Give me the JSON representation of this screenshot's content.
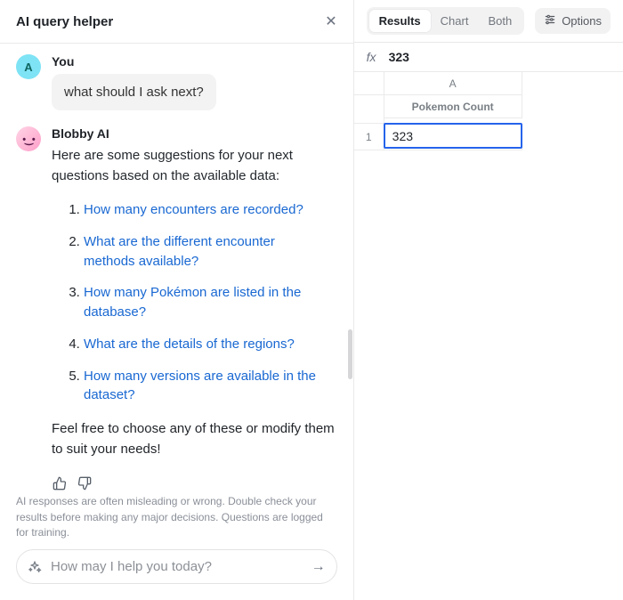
{
  "panel": {
    "title": "AI query helper"
  },
  "chat": {
    "user": {
      "name": "You",
      "avatar_letter": "A",
      "message": "what should I ask next?"
    },
    "ai": {
      "name": "Blobby AI",
      "avatar_face": "•‿•",
      "intro": "Here are some suggestions for your next questions based on the available data:",
      "suggestions": [
        "How many encounters are recorded?",
        "What are the different encounter methods available?",
        "How many Pokémon are listed in the database?",
        "What are the details of the regions?",
        "How many versions are available in the dataset?"
      ],
      "outro": "Feel free to choose any of these or modify them to suit your needs!"
    }
  },
  "disclaimer": "AI responses are often misleading or wrong. Double check your results before making any major decisions. Questions are logged for training.",
  "composer": {
    "placeholder": "How may I help you today?"
  },
  "results": {
    "tabs": {
      "results": "Results",
      "chart": "Chart",
      "both": "Both"
    },
    "options_label": "Options",
    "fx_label": "fx",
    "fx_value": "323",
    "col_letter": "A",
    "header_cell": "Pokemon Count",
    "row1_label": "1",
    "row1_value": "323"
  }
}
